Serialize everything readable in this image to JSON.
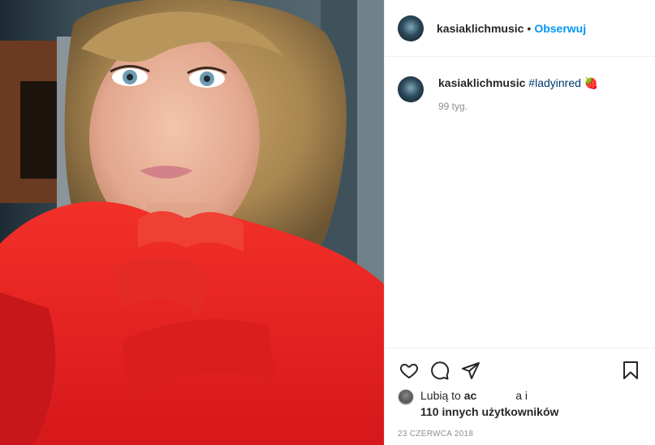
{
  "header": {
    "username": "kasiaklichmusic",
    "separator": "•",
    "follow_label": "Obserwuj"
  },
  "caption": {
    "username": "kasiaklichmusic",
    "hashtag": "#ladyinred",
    "emoji": "🍓",
    "time_ago": "99 tyg."
  },
  "actions": {
    "icons": [
      "heart-icon",
      "comment-icon",
      "share-icon",
      "bookmark-icon"
    ]
  },
  "likes": {
    "prefix": "Lubią to ",
    "partial_name": "ac",
    "suffix": "a i",
    "others": "110 innych użytkowników"
  },
  "date": "23 CZERWCA 2018",
  "colors": {
    "link": "#0095f6",
    "hashtag": "#00376b",
    "muted": "#8e8e8e",
    "blouse": "#e8231f"
  }
}
